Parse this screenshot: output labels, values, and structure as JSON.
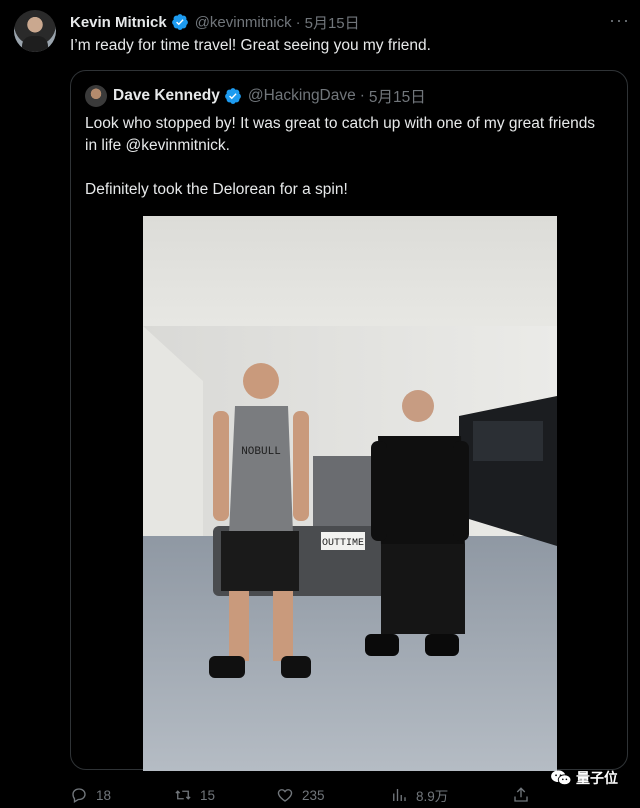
{
  "tweet": {
    "author_name": "Kevin Mitnick",
    "author_handle": "@kevinmitnick",
    "date_sep": "·",
    "date": "5月15日",
    "more": "···",
    "text": "I’m ready for time travel! Great seeing you my friend."
  },
  "quote": {
    "author_name": "Dave Kennedy",
    "author_handle": "@HackingDave",
    "date_sep": "·",
    "date": "5月15日",
    "paragraph1": "Look who stopped by! It was great to catch up with one of my great friends in life @kevinmitnick.",
    "paragraph2": "Definitely took the Delorean for a spin!",
    "photo": {
      "shirt_text": "NOBULL",
      "plate_text": "OUTTIME"
    }
  },
  "actions": {
    "reply_count": "18",
    "retweet_count": "15",
    "like_count": "235",
    "views_count": "8.9万",
    "share_label": ""
  },
  "watermark": {
    "text": "量子位"
  },
  "colors": {
    "background": "#000000",
    "text": "#e7e9ea",
    "muted": "#71767b",
    "verified": "#1d9bf0",
    "border": "#2f3336"
  }
}
